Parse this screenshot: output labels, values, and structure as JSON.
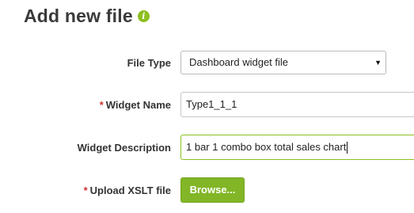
{
  "page": {
    "title": "Add new file",
    "info_icon": "info-icon",
    "info_icon_glyph": "i"
  },
  "form": {
    "required_marker": "*",
    "file_type": {
      "label": "File Type",
      "value": "Dashboard widget file",
      "arrow_glyph": "▼"
    },
    "widget_name": {
      "label": "Widget Name",
      "required": true,
      "value": "Type1_1_1"
    },
    "widget_description": {
      "label": "Widget Description",
      "value": "1 bar 1 combo box total sales chart"
    },
    "upload_xslt": {
      "label": "Upload XSLT file",
      "required": true,
      "button_label": "Browse..."
    }
  },
  "colors": {
    "accent_green": "#82b626",
    "required_red": "#cc3333",
    "title_text": "#3a3a3a"
  }
}
